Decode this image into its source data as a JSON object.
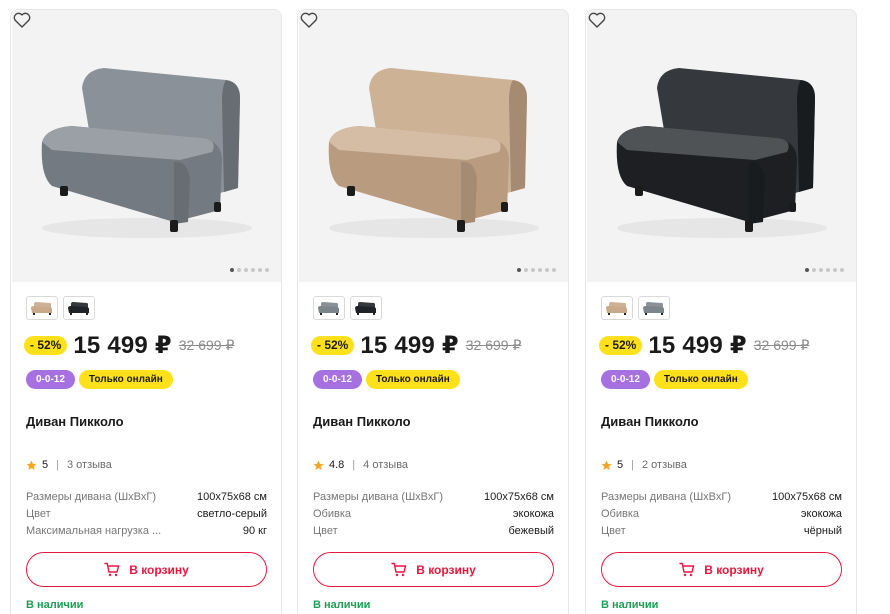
{
  "products": [
    {
      "title": "Диван Пикколо",
      "discount": "- 52%",
      "price": "15 499 ₽",
      "old_price": "32 699 ₽",
      "tags": {
        "installment": "0-0-12",
        "online": "Только онлайн"
      },
      "rating": {
        "value": "5",
        "reviews": "3 отзыва"
      },
      "specs": [
        {
          "name": "Размеры дивана (ШхВхГ)",
          "value": "100x75x68 см"
        },
        {
          "name": "Цвет",
          "value": "светло-серый"
        },
        {
          "name": "Максимальная нагрузка ...",
          "value": "90 кг"
        }
      ],
      "cart_label": "В корзину",
      "stock": "В наличии",
      "sofa_color": "#7d858c",
      "swatches": [
        {
          "icon": "sofa-beige-icon",
          "color": "#c8a98a"
        },
        {
          "icon": "sofa-black-icon",
          "color": "#1f2226"
        }
      ],
      "photo_total": 6,
      "photo_active": 1
    },
    {
      "title": "Диван Пикколо",
      "discount": "- 52%",
      "price": "15 499 ₽",
      "old_price": "32 699 ₽",
      "tags": {
        "installment": "0-0-12",
        "online": "Только онлайн"
      },
      "rating": {
        "value": "4.8",
        "reviews": "4 отзыва"
      },
      "specs": [
        {
          "name": "Размеры дивана (ШхВхГ)",
          "value": "100x75x68 см"
        },
        {
          "name": "Обивка",
          "value": "экокожа"
        },
        {
          "name": "Цвет",
          "value": "бежевый"
        }
      ],
      "cart_label": "В корзину",
      "stock": "В наличии",
      "sofa_color": "#c9a98a",
      "swatches": [
        {
          "icon": "sofa-grey-icon",
          "color": "#7d858c"
        },
        {
          "icon": "sofa-black-icon",
          "color": "#1f2226"
        }
      ],
      "photo_total": 6,
      "photo_active": 1
    },
    {
      "title": "Диван Пикколо",
      "discount": "- 52%",
      "price": "15 499 ₽",
      "old_price": "32 699 ₽",
      "tags": {
        "installment": "0-0-12",
        "online": "Только онлайн"
      },
      "rating": {
        "value": "5",
        "reviews": "2 отзыва"
      },
      "specs": [
        {
          "name": "Размеры дивана (ШхВхГ)",
          "value": "100x75x68 см"
        },
        {
          "name": "Обивка",
          "value": "экокожа"
        },
        {
          "name": "Цвет",
          "value": "чёрный"
        }
      ],
      "cart_label": "В корзину",
      "stock": "В наличии",
      "sofa_color": "#1f2226",
      "swatches": [
        {
          "icon": "sofa-beige-icon",
          "color": "#c8a98a"
        },
        {
          "icon": "sofa-grey-icon",
          "color": "#7d858c"
        }
      ],
      "photo_total": 6,
      "photo_active": 1
    }
  ],
  "colors": {
    "accent_red": "#e5173f",
    "discount_yellow": "#ffe11b",
    "installment_purple": "#a770e0",
    "stock_green": "#1f9d55",
    "star": "#f5a623"
  },
  "icons": {
    "favorite": "heart-outline-icon",
    "cart": "cart-icon",
    "rating": "star-icon"
  }
}
